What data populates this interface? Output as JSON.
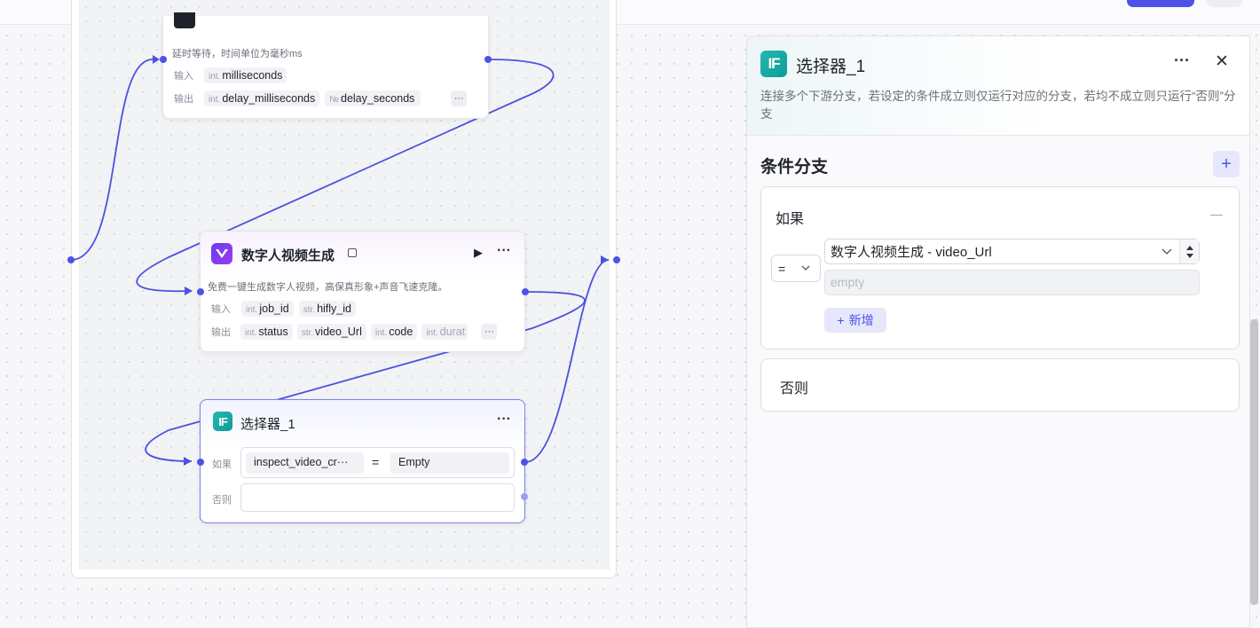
{
  "loop_nodes": {
    "delay": {
      "description": "延时等待，时间单位为毫秒ms",
      "input_label": "输入",
      "output_label": "输出",
      "inputs": [
        {
          "type": "int.",
          "name": "milliseconds"
        }
      ],
      "outputs": [
        {
          "type": "int.",
          "name": "delay_milliseconds"
        },
        {
          "type": "№",
          "name": "delay_seconds"
        }
      ],
      "more": "···"
    },
    "digital_human": {
      "title": "数字人视频生成",
      "description": "免费一键生成数字人视频，高保真形象+声音飞速克隆。",
      "input_label": "输入",
      "output_label": "输出",
      "inputs": [
        {
          "type": "int.",
          "name": "job_id"
        },
        {
          "type": "str.",
          "name": "hifly_id"
        }
      ],
      "outputs": [
        {
          "type": "int.",
          "name": "status"
        },
        {
          "type": "str.",
          "name": "video_Url"
        },
        {
          "type": "int.",
          "name": "code"
        },
        {
          "type": "int.",
          "name": "durat"
        }
      ],
      "run_icon": "▶",
      "more": "···"
    },
    "selector": {
      "title": "选择器_1",
      "icon_text": "IF",
      "if_label": "如果",
      "else_label": "否则",
      "condition_left": "inspect_video_cr···",
      "condition_op": "=",
      "condition_right": "Empty",
      "more": "···"
    }
  },
  "panel": {
    "icon_text": "IF",
    "title": "选择器_1",
    "more": "···",
    "close": "✕",
    "description": "连接多个下游分支，若设定的条件成立则仅运行对应的分支，若均不成立则只运行“否则”分支",
    "section_title": "条件分支",
    "add_icon": "+",
    "if_card": {
      "label": "如果",
      "collapse": "—",
      "operator": "=",
      "variable": "数字人视频生成 - video_Url",
      "value_placeholder": "empty",
      "add_button": "新增",
      "add_button_icon": "+"
    },
    "else_card": {
      "label": "否则"
    }
  },
  "colors": {
    "accent": "#4d53e8",
    "teal": "#14a8a3",
    "edge": "#4b52de"
  }
}
